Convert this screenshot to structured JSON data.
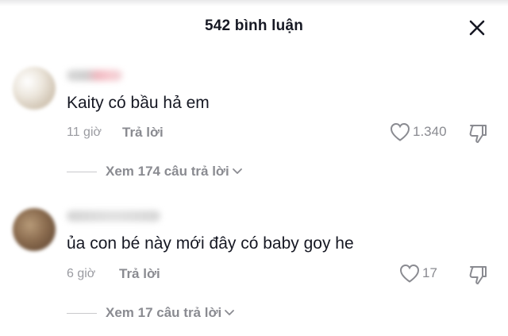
{
  "header": {
    "title": "542 bình luận",
    "close_icon": "close-icon"
  },
  "comments": [
    {
      "text": "Kaity có bầu hả em",
      "time": "11 giờ",
      "reply_label": "Trả lời",
      "likes": "1.340",
      "view_replies": "Xem 174 câu trả lời"
    },
    {
      "text": "ủa con bé này mới đây có baby goy he",
      "time": "6 giờ",
      "reply_label": "Trả lời",
      "likes": "17",
      "view_replies": "Xem 17 câu trả lời"
    }
  ],
  "icons": {
    "like": "heart-outline-icon",
    "dislike": "thumbs-down-icon",
    "expand": "chevron-down-icon",
    "close": "close-icon"
  }
}
